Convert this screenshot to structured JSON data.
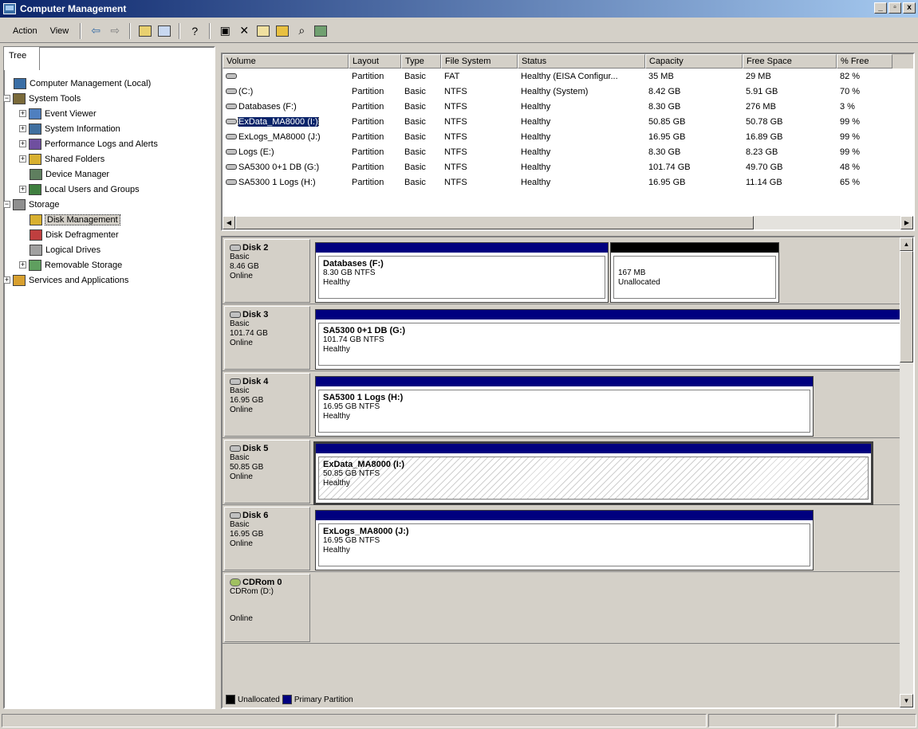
{
  "window": {
    "title": "Computer Management",
    "btn_min": "_",
    "btn_max": "▫",
    "btn_close": "x"
  },
  "toolbar": {
    "action": "Action",
    "view": "View"
  },
  "tree": {
    "tab": "Tree",
    "nodes": [
      {
        "label": "Computer Management (Local)",
        "depth": 0,
        "expander": "",
        "icon": "computer-icon",
        "color": "#3a6ea5"
      },
      {
        "label": "System Tools",
        "depth": 0,
        "expander": "−",
        "icon": "tools-icon",
        "color": "#7a6a3a"
      },
      {
        "label": "Event Viewer",
        "depth": 1,
        "expander": "+",
        "icon": "event-viewer-icon",
        "color": "#4f7fbf"
      },
      {
        "label": "System Information",
        "depth": 1,
        "expander": "+",
        "icon": "system-info-icon",
        "color": "#3f6f9f"
      },
      {
        "label": "Performance Logs and Alerts",
        "depth": 1,
        "expander": "+",
        "icon": "performance-icon",
        "color": "#6f4f9f"
      },
      {
        "label": "Shared Folders",
        "depth": 1,
        "expander": "+",
        "icon": "shared-folder-icon",
        "color": "#d8b030"
      },
      {
        "label": "Device Manager",
        "depth": 1,
        "expander": "",
        "icon": "device-manager-icon",
        "color": "#5f7f5f"
      },
      {
        "label": "Local Users and Groups",
        "depth": 1,
        "expander": "+",
        "icon": "users-icon",
        "color": "#3f7f3f"
      },
      {
        "label": "Storage",
        "depth": 0,
        "expander": "−",
        "icon": "storage-icon",
        "color": "#8f8f8f"
      },
      {
        "label": "Disk Management",
        "depth": 1,
        "expander": "",
        "icon": "disk-management-icon",
        "color": "#d8b030",
        "selected": true
      },
      {
        "label": "Disk Defragmenter",
        "depth": 1,
        "expander": "",
        "icon": "defrag-icon",
        "color": "#bf3f3f"
      },
      {
        "label": "Logical Drives",
        "depth": 1,
        "expander": "",
        "icon": "logical-drives-icon",
        "color": "#a0a0a0"
      },
      {
        "label": "Removable Storage",
        "depth": 1,
        "expander": "+",
        "icon": "removable-storage-icon",
        "color": "#5f9f5f"
      },
      {
        "label": "Services and Applications",
        "depth": 0,
        "expander": "+",
        "icon": "services-icon",
        "color": "#d8a030"
      }
    ]
  },
  "volumes": {
    "headers": [
      "Volume",
      "Layout",
      "Type",
      "File System",
      "Status",
      "Capacity",
      "Free Space",
      "% Free"
    ],
    "rows": [
      [
        "",
        "Partition",
        "Basic",
        "FAT",
        "Healthy (EISA Configur...",
        "35 MB",
        "29 MB",
        "82 %"
      ],
      [
        "(C:)",
        "Partition",
        "Basic",
        "NTFS",
        "Healthy (System)",
        "8.42 GB",
        "5.91 GB",
        "70 %"
      ],
      [
        "Databases (F:)",
        "Partition",
        "Basic",
        "NTFS",
        "Healthy",
        "8.30 GB",
        "276 MB",
        "3 %"
      ],
      [
        "ExData_MA8000 (I:)",
        "Partition",
        "Basic",
        "NTFS",
        "Healthy",
        "50.85 GB",
        "50.78 GB",
        "99 %"
      ],
      [
        "ExLogs_MA8000 (J:)",
        "Partition",
        "Basic",
        "NTFS",
        "Healthy",
        "16.95 GB",
        "16.89 GB",
        "99 %"
      ],
      [
        "Logs (E:)",
        "Partition",
        "Basic",
        "NTFS",
        "Healthy",
        "8.30 GB",
        "8.23 GB",
        "99 %"
      ],
      [
        "SA5300 0+1 DB (G:)",
        "Partition",
        "Basic",
        "NTFS",
        "Healthy",
        "101.74 GB",
        "49.70 GB",
        "48 %"
      ],
      [
        "SA5300 1 Logs (H:)",
        "Partition",
        "Basic",
        "NTFS",
        "Healthy",
        "16.95 GB",
        "11.14 GB",
        "65 %"
      ]
    ],
    "selected_row": 3
  },
  "disks": [
    {
      "name": "Disk 2",
      "type": "Basic",
      "size": "8.46 GB",
      "state": "Online",
      "partitions": [
        {
          "name": "Databases  (F:)",
          "detail": "8.30 GB NTFS",
          "status": "Healthy",
          "kind": "primary"
        },
        {
          "name": "",
          "detail": "167 MB",
          "status": "Unallocated",
          "kind": "unallocated"
        }
      ]
    },
    {
      "name": "Disk 3",
      "type": "Basic",
      "size": "101.74 GB",
      "state": "Online",
      "partitions": [
        {
          "name": "SA5300 0+1 DB  (G:)",
          "detail": "101.74 GB NTFS",
          "status": "Healthy",
          "kind": "primary"
        }
      ]
    },
    {
      "name": "Disk 4",
      "type": "Basic",
      "size": "16.95 GB",
      "state": "Online",
      "partitions": [
        {
          "name": "SA5300 1 Logs  (H:)",
          "detail": "16.95 GB NTFS",
          "status": "Healthy",
          "kind": "primary"
        }
      ]
    },
    {
      "name": "Disk 5",
      "type": "Basic",
      "size": "50.85 GB",
      "state": "Online",
      "partitions": [
        {
          "name": "ExData_MA8000  (I:)",
          "detail": "50.85 GB NTFS",
          "status": "Healthy",
          "kind": "primary",
          "selected": true
        }
      ]
    },
    {
      "name": "Disk 6",
      "type": "Basic",
      "size": "16.95 GB",
      "state": "Online",
      "partitions": [
        {
          "name": "ExLogs_MA8000  (J:)",
          "detail": "16.95 GB NTFS",
          "status": "Healthy",
          "kind": "primary"
        }
      ]
    }
  ],
  "cdrom": {
    "name": "CDRom 0",
    "drive": "CDRom (D:)",
    "state": "Online"
  },
  "legend": {
    "unallocated": "Unallocated",
    "primary": "Primary Partition",
    "color_unallocated": "#000000",
    "color_primary": "#00007f"
  }
}
